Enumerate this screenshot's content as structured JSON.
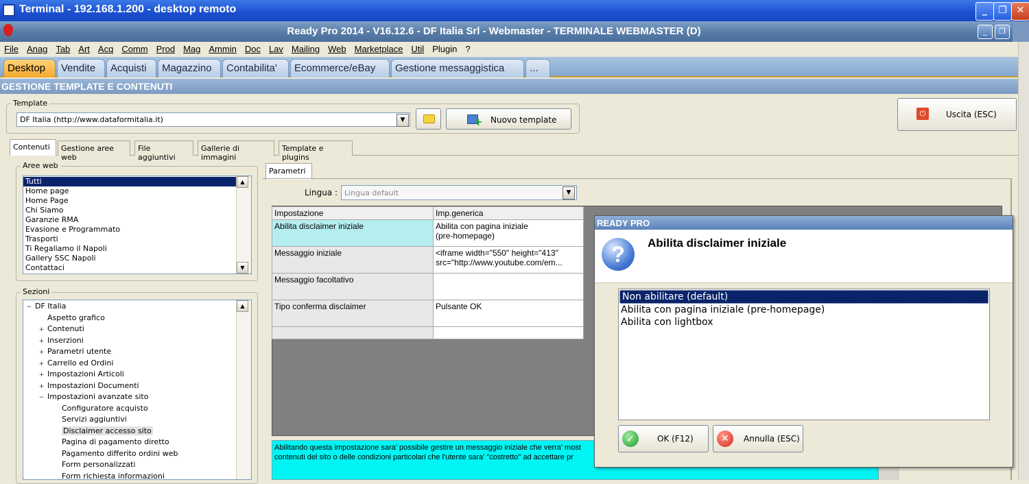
{
  "window": {
    "title": "Terminal - 192.168.1.200 - desktop remoto",
    "app_title": "Ready Pro 2014 - V16.12.6 - DF Italia Srl - Webmaster - TERMINALE WEBMASTER (D)"
  },
  "menu": [
    "File",
    "Anag",
    "Tab",
    "Art",
    "Acq",
    "Comm",
    "Prod",
    "Mag",
    "Ammin",
    "Doc",
    "Lav",
    "Mailing",
    "Web",
    "Marketplace",
    "Util",
    "Plugin",
    "?"
  ],
  "module_tabs": [
    "Desktop",
    "Vendite",
    "Acquisti",
    "Magazzino",
    "Contabilita'",
    "Ecommerce/eBay",
    "Gestione messaggistica",
    "..."
  ],
  "section_header": "GESTIONE TEMPLATE E CONTENUTI",
  "template": {
    "label": "Template",
    "value": "DF Italia (http://www.dataformitalia.it)",
    "new_button": "Nuovo template"
  },
  "exit_button": "Uscita (ESC)",
  "content_tabs": [
    "Contenuti",
    "Gestione aree web",
    "File aggiuntivi",
    "Gallerie di immagini",
    "Template e plugins"
  ],
  "aree_web": {
    "label": "Aree web",
    "items": [
      "Tutti",
      "Home page",
      "Home Page",
      "Chi Siamo",
      "Garanzie RMA",
      "Evasione e Programmato",
      "Trasporti",
      "Ti Regaliamo il Napoli",
      "Gallery SSC Napoli",
      "Contattaci"
    ]
  },
  "sezioni": {
    "label": "Sezioni",
    "items": [
      {
        "text": "DF Italia",
        "level": 0,
        "exp": "-"
      },
      {
        "text": "Aspetto grafico",
        "level": 1,
        "exp": ""
      },
      {
        "text": "Contenuti",
        "level": 1,
        "exp": "+"
      },
      {
        "text": "Inserzioni",
        "level": 1,
        "exp": "+"
      },
      {
        "text": "Parametri utente",
        "level": 1,
        "exp": "+"
      },
      {
        "text": "Carrello ed Ordini",
        "level": 1,
        "exp": "+"
      },
      {
        "text": "Impostazioni Articoli",
        "level": 1,
        "exp": "+"
      },
      {
        "text": "Impostazioni Documenti",
        "level": 1,
        "exp": "+"
      },
      {
        "text": "Impostazioni avanzate sito",
        "level": 1,
        "exp": "-"
      },
      {
        "text": "Configuratore acquisto",
        "level": 2,
        "exp": ""
      },
      {
        "text": "Servizi aggiuntivi",
        "level": 2,
        "exp": ""
      },
      {
        "text": "Disclaimer accesso sito",
        "level": 2,
        "exp": ""
      },
      {
        "text": "Pagina di pagamento diretto",
        "level": 2,
        "exp": ""
      },
      {
        "text": "Pagamento differito ordini web",
        "level": 2,
        "exp": ""
      },
      {
        "text": "Form personalizzati",
        "level": 2,
        "exp": ""
      },
      {
        "text": "Form richiesta informazioni",
        "level": 2,
        "exp": ""
      }
    ]
  },
  "parametri": {
    "tab": "Parametri",
    "lingua_label": "Lingua :",
    "lingua_value": "Lingua default",
    "col_impostazione": "Impostazione",
    "col_generica": "Imp.generica",
    "rows": [
      {
        "key": "Abilita disclaimer iniziale",
        "val1": "Abilita con pagina iniziale",
        "val2": "(pre-homepage)"
      },
      {
        "key": "Messaggio iniziale",
        "val1": "<iframe width=\"550\" height=\"413\"",
        "val2": "src=\"http://www.youtube.com/em..."
      },
      {
        "key": "Messaggio facoltativo",
        "val1": "",
        "val2": ""
      },
      {
        "key": "Tipo conferma disclaimer",
        "val1": "Pulsante OK",
        "val2": ""
      }
    ],
    "description_line1": "Abilitando questa impostazione sara' possibile gestire un messaggio iniziale che verra' most",
    "description_line2": "contenuti del sito o delle condizioni particolari che l'utente sara' \"costretto\" ad accettare pr"
  },
  "dialog": {
    "title": "READY PRO",
    "heading": "Abilita disclaimer iniziale",
    "options": [
      "Non abilitare (default)",
      "Abilita con pagina iniziale (pre-homepage)",
      "Abilita con lightbox"
    ],
    "ok_button": "OK (F12)",
    "cancel_button": "Annulla (ESC)"
  },
  "colors": {
    "selection": "#0a246a",
    "highlight_cell": "#b6eef0",
    "description_bg": "#00f4f4",
    "active_tab": "#f4a92c"
  }
}
